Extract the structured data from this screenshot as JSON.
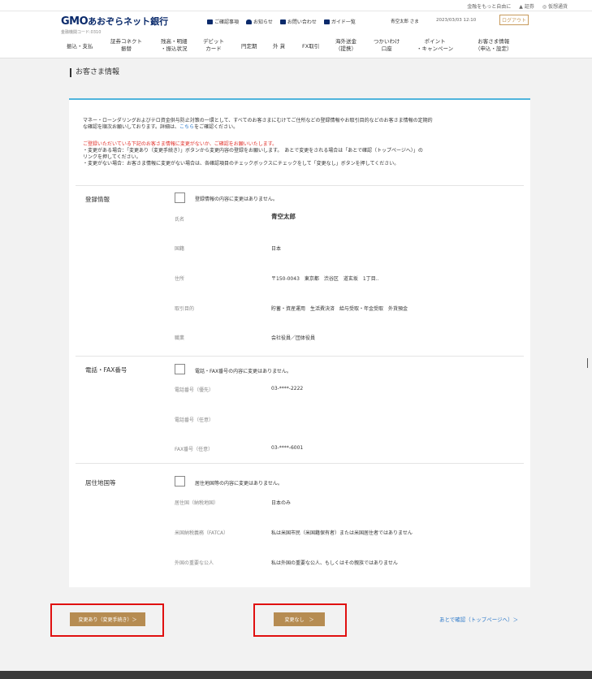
{
  "topbar": {
    "items": [
      "金融をもっと自由に",
      "証券",
      "仮想通貨"
    ]
  },
  "header": {
    "logo_gmo": "GMO",
    "logo_rest": "あおぞらネット銀行",
    "bank_code": "金融機関コード:0310",
    "links": [
      "ご確認事項",
      "お知らせ",
      "お問い合わせ",
      "ガイド一覧"
    ],
    "user": "青空太郎 さま",
    "timestamp": "2023/03/03 12:10",
    "logout": "ログアウト"
  },
  "gnav": [
    {
      "l1": "振込・支払",
      "l2": ""
    },
    {
      "l1": "証券コネクト",
      "l2": "振替"
    },
    {
      "l1": "残高・明細",
      "l2": "・振込状況"
    },
    {
      "l1": "デビット",
      "l2": "カード"
    },
    {
      "l1": "円定期",
      "l2": ""
    },
    {
      "l1": "外 貨",
      "l2": ""
    },
    {
      "l1": "FX取引",
      "l2": ""
    },
    {
      "l1": "海外送金",
      "l2": "（提携）"
    },
    {
      "l1": "つかいわけ",
      "l2": "口座"
    },
    {
      "l1": "ポイント",
      "l2": "・キャンペーン"
    },
    {
      "l1": "お客さま情報",
      "l2": "（申込・設定）"
    }
  ],
  "page_title": "お客さま情報",
  "intro": {
    "line1": "マネー・ローンダリングおよびテロ資金供与防止対策の一環として、すべてのお客さまにむけてご住所などの登録情報やお取引目的などのお客さま情報の定期的",
    "line2_a": "な確認を順次お願いしております。詳細は、",
    "line2_link": "こちら",
    "line2_b": "をご確認ください。"
  },
  "warn": {
    "red1": "ご登録いただいている下記のお客さま情報に変更がないか、ご確認をお願いいたします。",
    "line2": "・変更がある場合：「変更あり（変更手続き）」ボタンから変更内容の登録をお願いします。　あとで変更をされる場合は「あとで確認（トップページへ）」の",
    "line3": "リンクを押してください。",
    "line4": "・変更がない場合：お客さま情報に変更がない場合は、各確認項目のチェックボックスにチェックをして「変更なし」ボタンを押してください。"
  },
  "sections": {
    "registration": {
      "title": "登録情報",
      "check_label": "登録情報の内容に変更はありません。",
      "rows": [
        {
          "label": "氏名",
          "value": "青空太郎"
        },
        {
          "label": "国籍",
          "value": "日本"
        },
        {
          "label": "住所",
          "value": "〒150-0043　東京都　渋谷区　道玄坂　1丁目.."
        },
        {
          "label": "取引目的",
          "value": "貯蓄・資産運用　生活費決済　給与受取・年金受取　外貨預金"
        },
        {
          "label": "職業",
          "value": "会社役員／団体役員"
        }
      ]
    },
    "phone": {
      "title": "電話・FAX番号",
      "check_label": "電話・FAX番号の内容に変更はありません。",
      "rows": [
        {
          "label": "電話番号（優先）",
          "value": "03-****-2222"
        },
        {
          "label": "電話番号（任意）",
          "value": ""
        },
        {
          "label": "FAX番号（任意）",
          "value": "03-****-6001"
        }
      ]
    },
    "residence": {
      "title": "居住地国等",
      "check_label": "居住地国等の内容に変更はありません。",
      "rows": [
        {
          "label": "居住国（納税地国）",
          "value": "日本のみ"
        },
        {
          "label": "米国納税義務（FATCA）",
          "value": "私は米国市民（米国籍保有者）または米国居住者ではありません"
        },
        {
          "label": "外国の重要な公人",
          "value": "私は外国の重要な公人、もしくはその親族ではありません"
        }
      ]
    }
  },
  "buttons": {
    "change": "変更あり（変更手続き）＞",
    "no_change": "変更なし　＞",
    "later": "あとで確認（トップページへ）＞"
  },
  "colors": {
    "brand": "#0a2a6b",
    "button": "#b68c52",
    "accent_line": "#4fb4dc",
    "highlight": "#e01010",
    "link": "#2b78c9"
  }
}
